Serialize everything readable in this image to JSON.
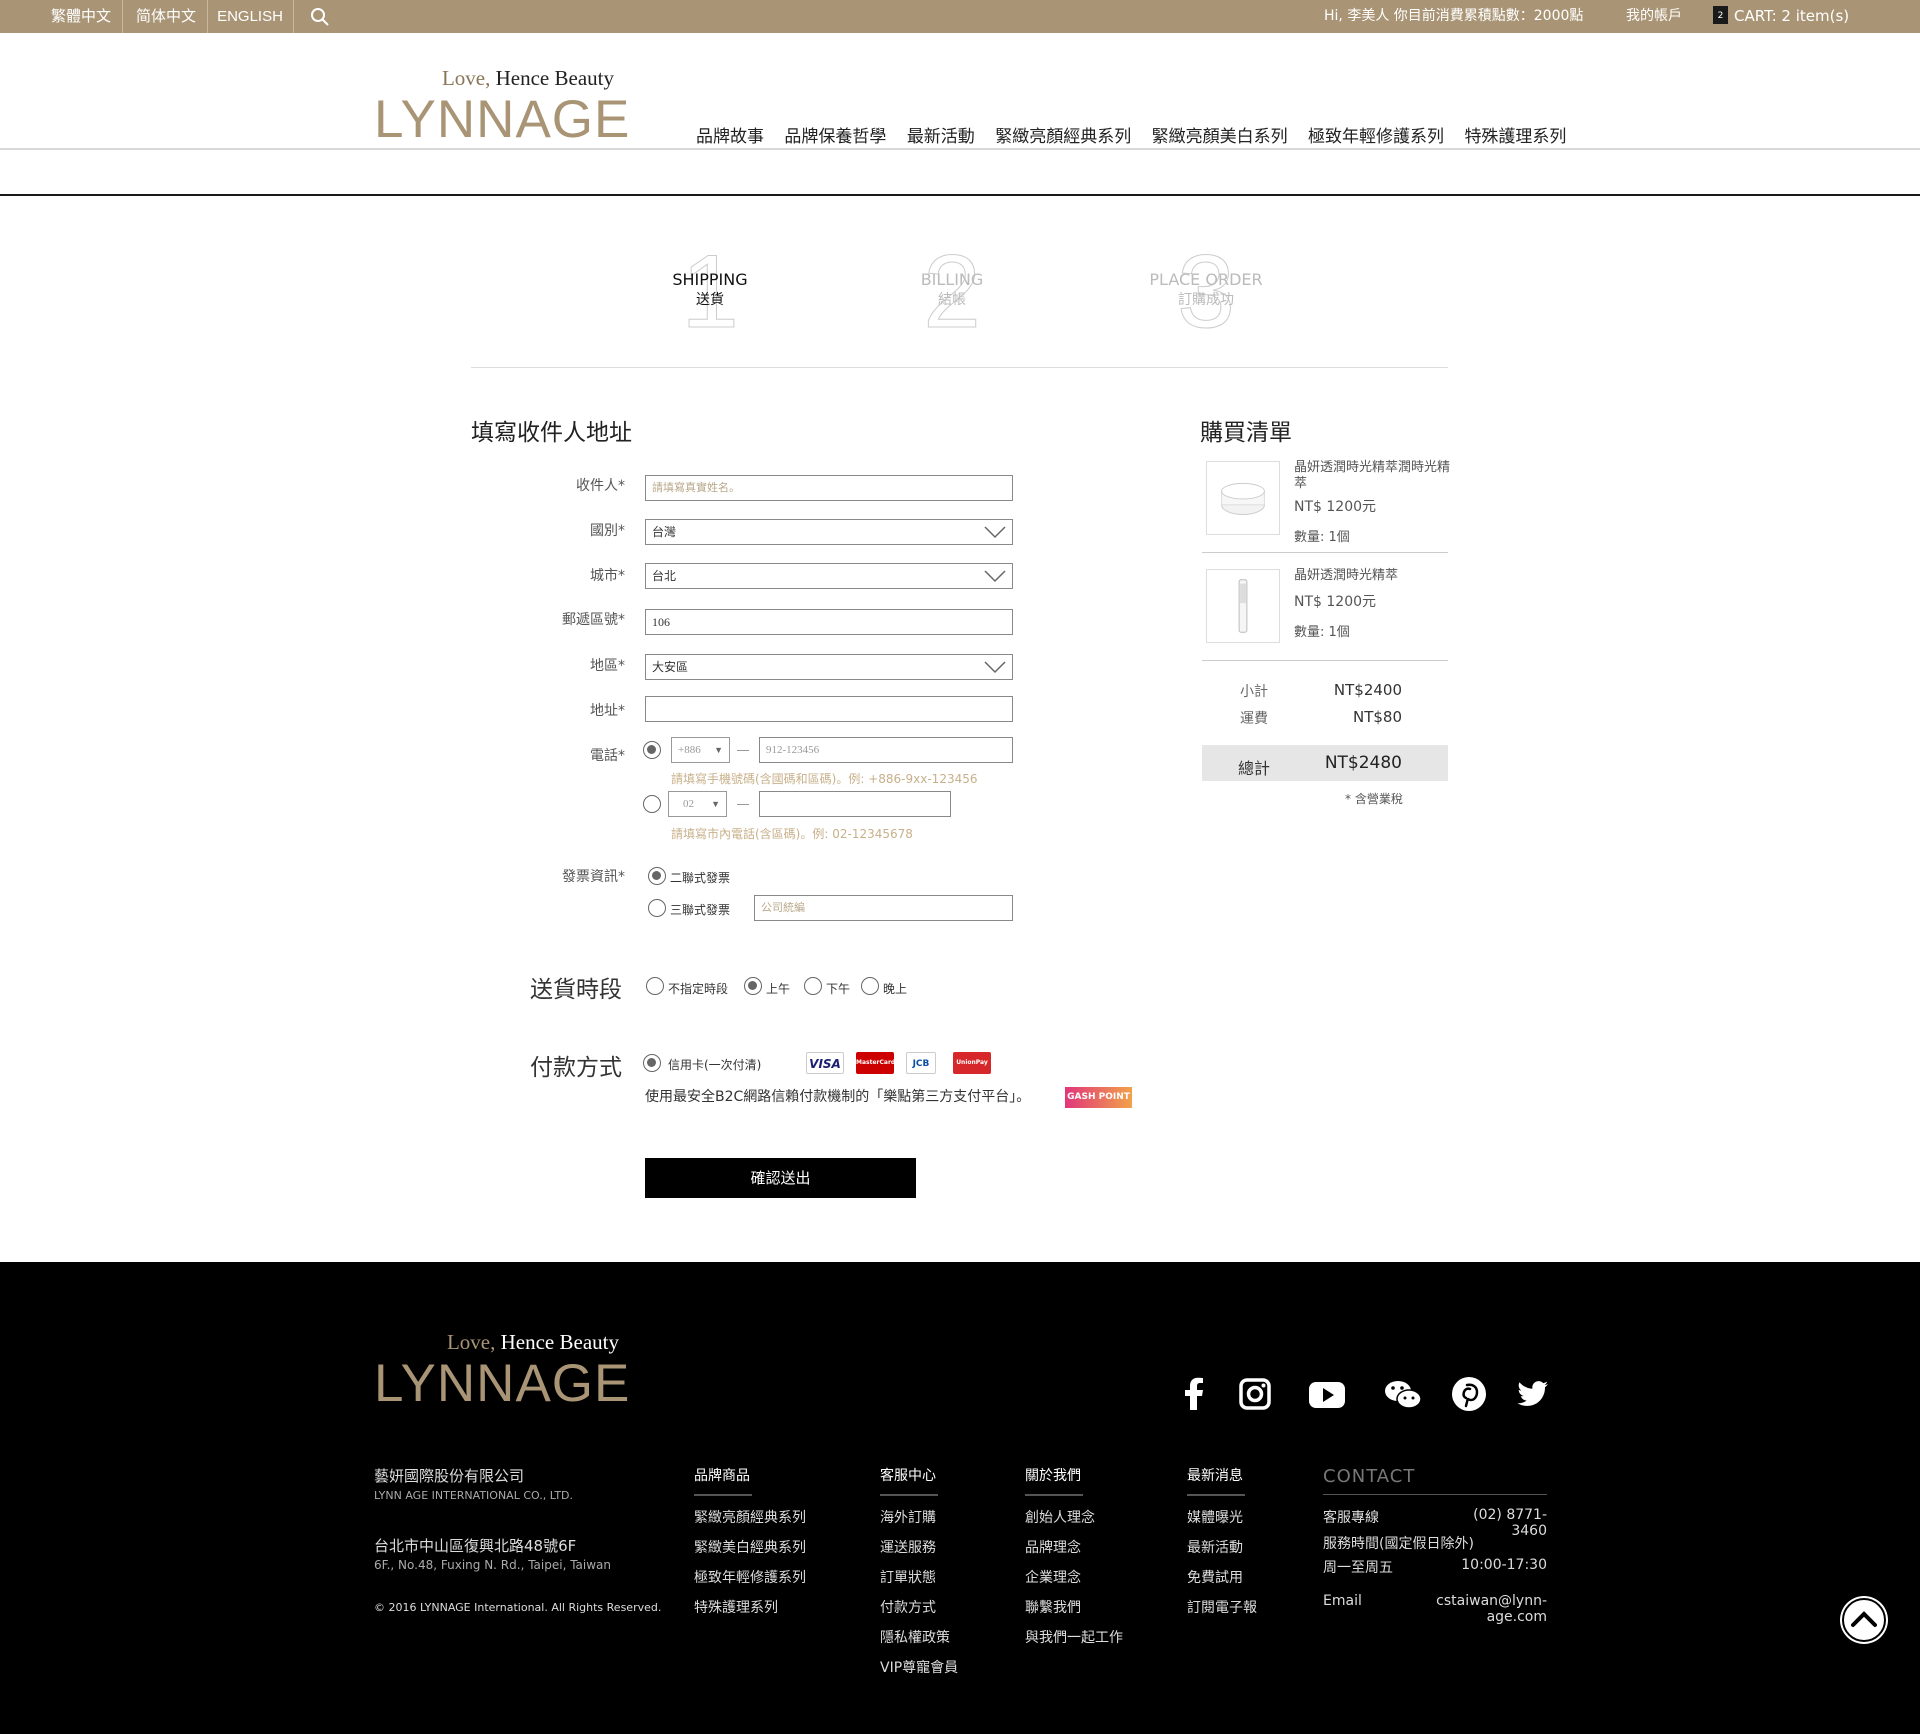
{
  "topbar": {
    "langs": [
      "繁體中文",
      "简体中文",
      "ENGLISH"
    ],
    "greeting": "Hi, 李美人  你目前消費累積點數：2000點",
    "account": "我的帳戶",
    "cart_count": "2",
    "cart": "CART: 2 item(s)"
  },
  "logo": {
    "tag_love": "Love,",
    "tag_rest": " Hence Beauty",
    "word": "LYNNAGE"
  },
  "nav": [
    "品牌故事",
    "品牌保養哲學",
    "最新活動",
    "緊緻亮顏經典系列",
    "緊緻亮顏美白系列",
    "極致年輕修護系列",
    "特殊護理系列"
  ],
  "steps": [
    {
      "num": "1",
      "en": "SHIPPING",
      "zh": "送貨"
    },
    {
      "num": "2",
      "en": "BILLING",
      "zh": "結帳"
    },
    {
      "num": "3",
      "en": "PLACE ORDER",
      "zh": "訂購成功"
    }
  ],
  "form": {
    "title": "填寫收件人地址",
    "recipient_label": "收件人*",
    "recipient_placeholder": "請填寫真實姓名。",
    "country_label": "國別*",
    "country_value": "台灣",
    "city_label": "城市*",
    "city_value": "台北",
    "zip_label": "郵遞區號*",
    "zip_value": "106",
    "district_label": "地區*",
    "district_value": "大安區",
    "address_label": "地址*",
    "phone_label": "電話*",
    "mobile_code": "+886",
    "mobile_placeholder": "912-123456",
    "mobile_hint": "請填寫手機號碼(含國碼和區碼)。例: +886-9xx-123456",
    "landline_code": "02",
    "landline_hint": "請填寫市內電話(含區碼)。例: 02-12345678",
    "invoice_label": "發票資訊*",
    "invoice_opt1": "二聯式發票",
    "invoice_opt2": "三聯式發票",
    "tax_id_placeholder": "公司統編",
    "delivery_title": "送貨時段",
    "delivery_opts": [
      "不指定時段",
      "上午",
      "下午",
      "晚上"
    ],
    "payment_title": "付款方式",
    "payment_opt": "信用卡(一次付清)",
    "card_labels": [
      "VISA",
      "MasterCard",
      "JCB",
      "UnionPay"
    ],
    "payment_note": "使用最安全B2C網路信賴付款機制的「樂點第三方支付平台」。",
    "gash_label": "GASH POINT",
    "submit": "確認送出"
  },
  "cart": {
    "title": "購買清單",
    "items": [
      {
        "name": "晶妍透潤時光精萃潤時光精萃",
        "price": "NT$ 1200元",
        "qty": "數量: 1個"
      },
      {
        "name": "晶妍透潤時光精萃",
        "price": "NT$ 1200元",
        "qty": "數量: 1個"
      }
    ],
    "subtotal_label": "小計",
    "subtotal": "NT$2400",
    "shipping_label": "運費",
    "shipping": "NT$80",
    "total_label": "總計",
    "total": "NT$2480",
    "tax_note": "* 含營業稅"
  },
  "footer": {
    "company": "藝妍國際股份有限公司",
    "company_en": "LYNN AGE INTERNATIONAL CO., LTD.",
    "address": "台北市中山區復興北路48號6F",
    "address_en": "6F., No.48, Fuxing N. Rd., Taipei, Taiwan",
    "copyright": "© 2016 LYNNAGE International. All Rights Reserved.",
    "cols": [
      {
        "head": "品牌商品",
        "links": [
          "緊緻亮顏經典系列",
          "緊緻美白經典系列",
          "極致年輕修護系列",
          "特殊護理系列"
        ]
      },
      {
        "head": "客服中心",
        "links": [
          "海外訂購",
          "運送服務",
          "訂單狀態",
          "付款方式",
          "隱私權政策",
          "VIP尊寵會員"
        ]
      },
      {
        "head": "關於我們",
        "links": [
          "創始人理念",
          "品牌理念",
          "企業理念",
          "聯繫我們",
          "與我們一起工作"
        ]
      },
      {
        "head": "最新消息",
        "links": [
          "媒體曝光",
          "最新活動",
          "免費試用",
          "訂閱電子報"
        ]
      }
    ],
    "contact_head": "CONTACT",
    "hotline_label": "客服專線",
    "hotline": "(02) 8771-3460",
    "hours_label": "服務時間(國定假日除外)",
    "days": "周一至周五",
    "hours": "10:00-17:30",
    "email_label": "Email",
    "email": "cstaiwan@lynn-age.com"
  },
  "colors": {
    "brand": "#a99575",
    "hint": "#c8b08a"
  }
}
